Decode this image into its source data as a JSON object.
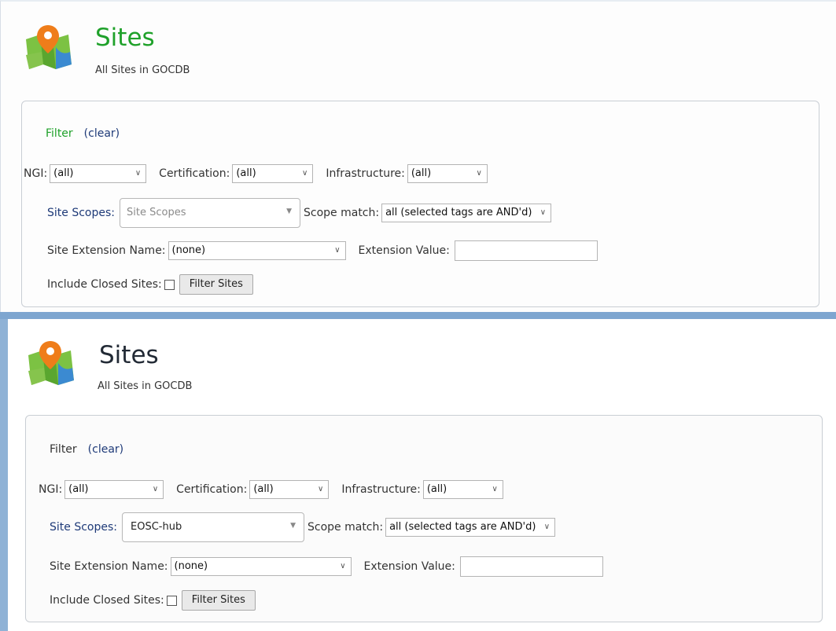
{
  "panels": [
    {
      "title": "Sites",
      "subtitle": "All Sites in GOCDB",
      "filter_label": "Filter",
      "clear_label": "(clear)",
      "ngi_label": "NGI:",
      "ngi_value": "(all)",
      "cert_label": "Certification:",
      "cert_value": "(all)",
      "infra_label": "Infrastructure:",
      "infra_value": "(all)",
      "scopes_label": "Site Scopes:",
      "scopes_placeholder": "Site Scopes",
      "scope_match_label": "Scope match:",
      "scope_match_value": "all (selected tags are AND'd)",
      "ext_name_label": "Site Extension Name:",
      "ext_name_value": "(none)",
      "ext_value_label": "Extension Value:",
      "closed_label": "Include Closed Sites:",
      "filter_button": "Filter Sites"
    },
    {
      "title": "Sites",
      "subtitle": "All Sites in GOCDB",
      "filter_label": "Filter",
      "clear_label": "(clear)",
      "ngi_label": "NGI:",
      "ngi_value": "(all)",
      "cert_label": "Certification:",
      "cert_value": "(all)",
      "infra_label": "Infrastructure:",
      "infra_value": "(all)",
      "scopes_label": "Site Scopes:",
      "scopes_value": "EOSC-hub",
      "scope_match_label": "Scope match:",
      "scope_match_value": "all (selected tags are AND'd)",
      "ext_name_label": "Site Extension Name:",
      "ext_name_value": "(none)",
      "ext_value_label": "Extension Value:",
      "closed_label": "Include Closed Sites:",
      "filter_button": "Filter Sites"
    }
  ],
  "icons": {
    "map": "map-pin-icon",
    "dropdown": "chevron-down-icon",
    "multiselect": "triangle-down-icon"
  },
  "colors": {
    "title_active": "#1fa12a",
    "title_default": "#222a35",
    "link": "#1e3a78",
    "separator": "#7ea6d0"
  }
}
